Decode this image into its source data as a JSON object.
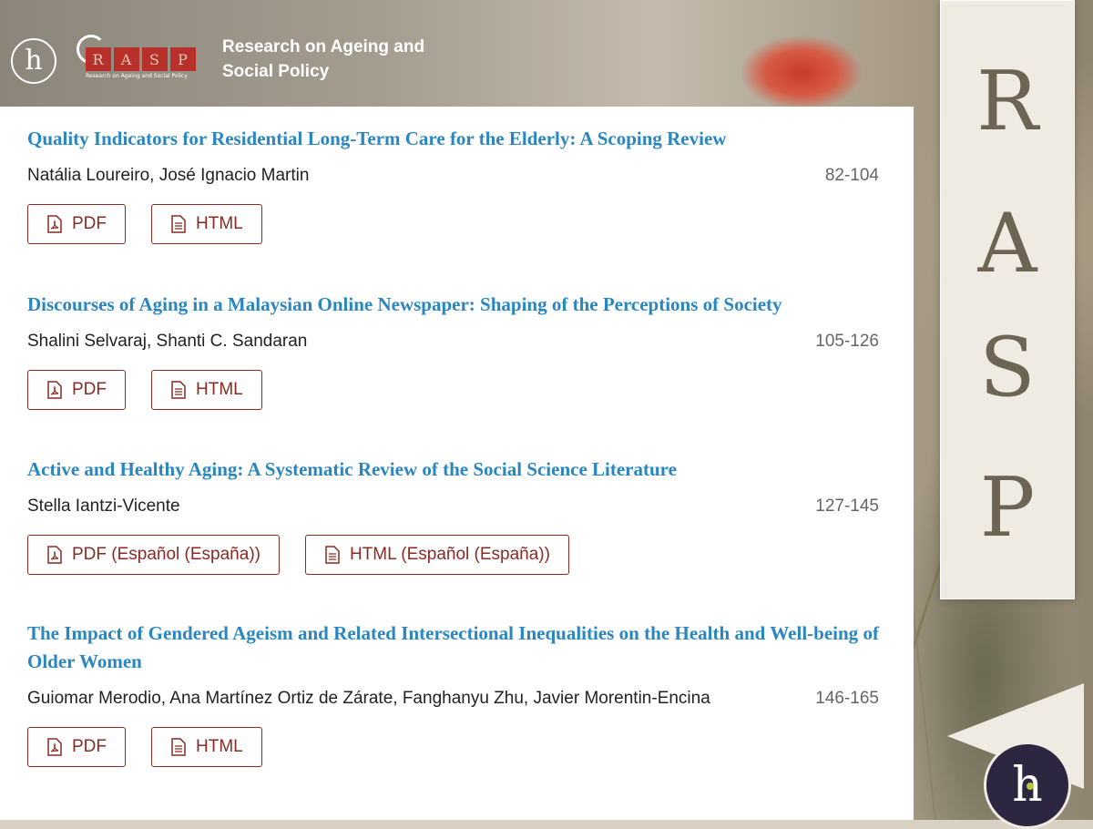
{
  "header": {
    "title_line1": "Research on Ageing and",
    "title_line2": "Social Policy",
    "logo_h": "h",
    "rasp_letters": [
      "R",
      "A",
      "S",
      "P"
    ],
    "rasp_subtitle": "Research on Ageing and Social Policy"
  },
  "side_banner": {
    "letters": [
      "R",
      "A",
      "S",
      "P"
    ],
    "badge": "h"
  },
  "articles": [
    {
      "title": "Quality Indicators for Residential Long-Term Care for the Elderly: A Scoping Review",
      "authors": "Natália Loureiro, José Ignacio Martin",
      "pages": "82-104",
      "pdf_label": "PDF",
      "html_label": "HTML"
    },
    {
      "title": "Discourses of Aging in a Malaysian Online Newspaper: Shaping of the Perceptions of Society",
      "authors": "Shalini Selvaraj, Shanti C. Sandaran",
      "pages": "105-126",
      "pdf_label": "PDF",
      "html_label": "HTML"
    },
    {
      "title": "Active and Healthy Aging: A Systematic Review of the Social Science Literature",
      "authors": "Stella Iantzi-Vicente",
      "pages": "127-145",
      "pdf_label": "PDF (Español (España))",
      "html_label": "HTML (Español (España))"
    },
    {
      "title": "The Impact of Gendered Ageism and Related Intersectional Inequalities on the Health and Well-being of Older Women",
      "authors": "Guiomar Merodio, Ana Martínez Ortiz de Zárate, Fanghanyu Zhu, Javier Morentin-Encina",
      "pages": "146-165",
      "pdf_label": "PDF",
      "html_label": "HTML"
    }
  ],
  "colors": {
    "title_link": "#2a86c0",
    "button_accent": "#8b2a22",
    "rasp_red": "#b8302a"
  },
  "icons": {
    "pdf": "pdf-file-icon",
    "html": "document-icon"
  }
}
